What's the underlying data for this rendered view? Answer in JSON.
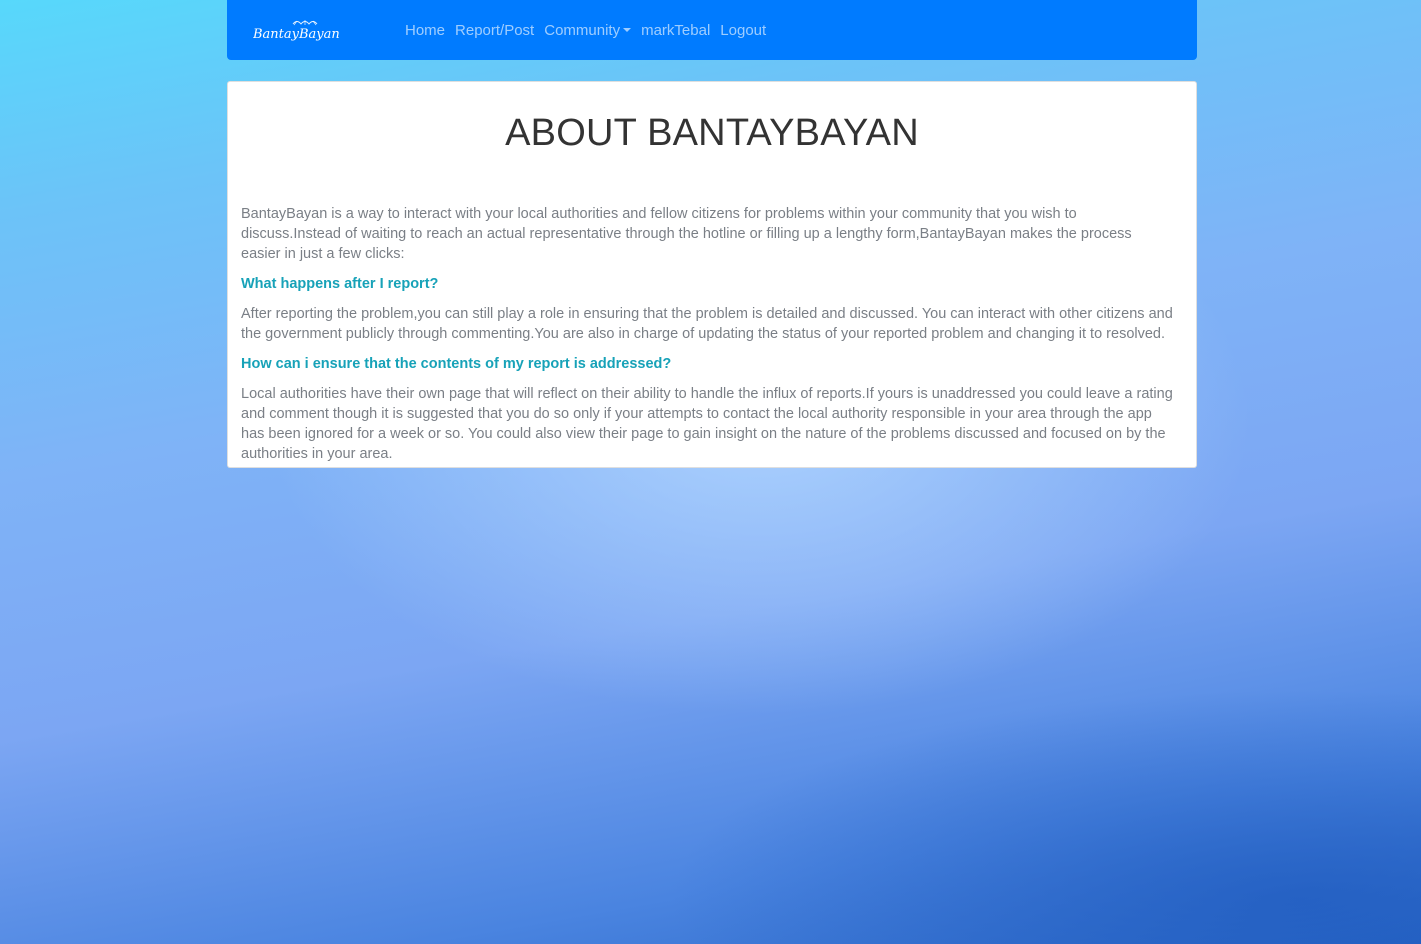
{
  "brand": {
    "logo_text": "BantayBayan"
  },
  "nav": {
    "home": "Home",
    "report_post": "Report/Post",
    "community": "Community",
    "user": "markTebal",
    "logout": "Logout"
  },
  "about": {
    "title": "ABOUT BANTAYBAYAN",
    "intro": "BantayBayan is a way to interact with your local authorities and fellow citizens for problems within your community that you wish to discuss.Instead of waiting to reach an actual representative through the hotline or filling up a lengthy form,BantayBayan makes the process easier in just a few clicks:",
    "q1": "What happens after I report?",
    "a1": "After reporting the problem,you can still play a role in ensuring that the problem is detailed and discussed. You can interact with other citizens and the government publicly through commenting.You are also in charge of updating the status of your reported problem and changing it to resolved.",
    "q2": "How can i ensure that the contents of my report is addressed?",
    "a2": "Local authorities have their own page that will reflect on their ability to handle the influx of reports.If yours is unaddressed you could leave a rating and comment though it is suggested that you do so only if your attempts to contact the local authority responsible in your area through the app has been ignored for a week or so. You could also view their page to gain insight on the nature of the problems discussed and focused on by the authorities in your area."
  },
  "colors": {
    "navbar": "#007bff",
    "heading_accent": "#17a2b8"
  }
}
